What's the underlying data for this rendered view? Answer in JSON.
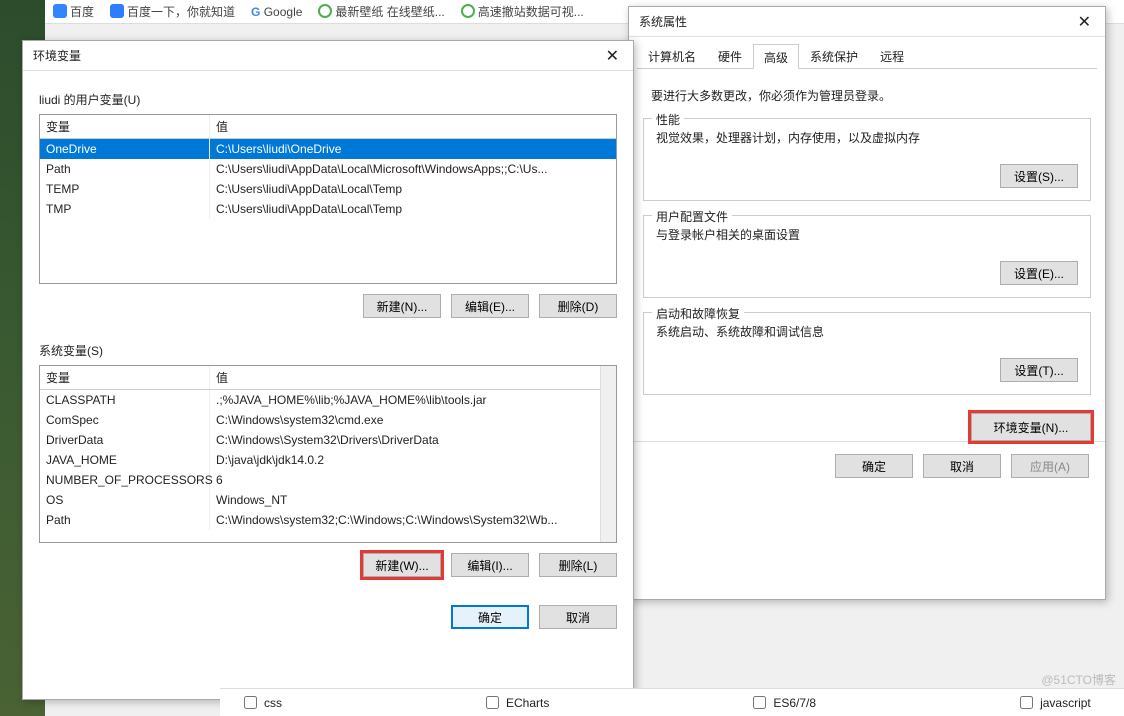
{
  "bookmarks": {
    "baidu": "百度",
    "baidu2": "百度一下，你就知道",
    "google": "Google",
    "wall": "最新壁纸 在线壁纸...",
    "gaosu": "高速撤站数据可视..."
  },
  "envDialog": {
    "title": "环境变量",
    "userVarsLabel": "liudi 的用户变量(U)",
    "headers": {
      "var": "变量",
      "val": "值"
    },
    "userVars": [
      {
        "var": "OneDrive",
        "val": "C:\\Users\\liudi\\OneDrive"
      },
      {
        "var": "Path",
        "val": "C:\\Users\\liudi\\AppData\\Local\\Microsoft\\WindowsApps;;C:\\Us..."
      },
      {
        "var": "TEMP",
        "val": "C:\\Users\\liudi\\AppData\\Local\\Temp"
      },
      {
        "var": "TMP",
        "val": "C:\\Users\\liudi\\AppData\\Local\\Temp"
      }
    ],
    "newN": "新建(N)...",
    "editE": "编辑(E)...",
    "delD": "删除(D)",
    "sysVarsLabel": "系统变量(S)",
    "sysVars": [
      {
        "var": "CLASSPATH",
        "val": ".;%JAVA_HOME%\\lib;%JAVA_HOME%\\lib\\tools.jar"
      },
      {
        "var": "ComSpec",
        "val": "C:\\Windows\\system32\\cmd.exe"
      },
      {
        "var": "DriverData",
        "val": "C:\\Windows\\System32\\Drivers\\DriverData"
      },
      {
        "var": "JAVA_HOME",
        "val": "D:\\java\\jdk\\jdk14.0.2"
      },
      {
        "var": "NUMBER_OF_PROCESSORS",
        "val": "6"
      },
      {
        "var": "OS",
        "val": "Windows_NT"
      },
      {
        "var": "Path",
        "val": "C:\\Windows\\system32;C:\\Windows;C:\\Windows\\System32\\Wb..."
      }
    ],
    "newW": "新建(W)...",
    "editI": "编辑(I)...",
    "delL": "删除(L)",
    "ok": "确定",
    "cancel": "取消"
  },
  "sysProps": {
    "title": "系统属性",
    "tabs": [
      "计算机名",
      "硬件",
      "高级",
      "系统保护",
      "远程"
    ],
    "activeTab": 2,
    "note": "要进行大多数更改，你必须作为管理员登录。",
    "perf": {
      "title": "性能",
      "text": "视觉效果，处理器计划，内存使用，以及虚拟内存",
      "btn": "设置(S)..."
    },
    "userProfile": {
      "title": "用户配置文件",
      "text": "与登录帐户相关的桌面设置",
      "btn": "设置(E)..."
    },
    "startup": {
      "title": "启动和故障恢复",
      "text": "系统启动、系统故障和调试信息",
      "btn": "设置(T)..."
    },
    "envBtn": "环境变量(N)...",
    "ok": "确定",
    "cancel": "取消",
    "apply": "应用(A)"
  },
  "strip": {
    "css": "css",
    "echarts": "ECharts",
    "es": "ES6/7/8",
    "js": "javascript"
  },
  "watermark": "@51CTO博客"
}
